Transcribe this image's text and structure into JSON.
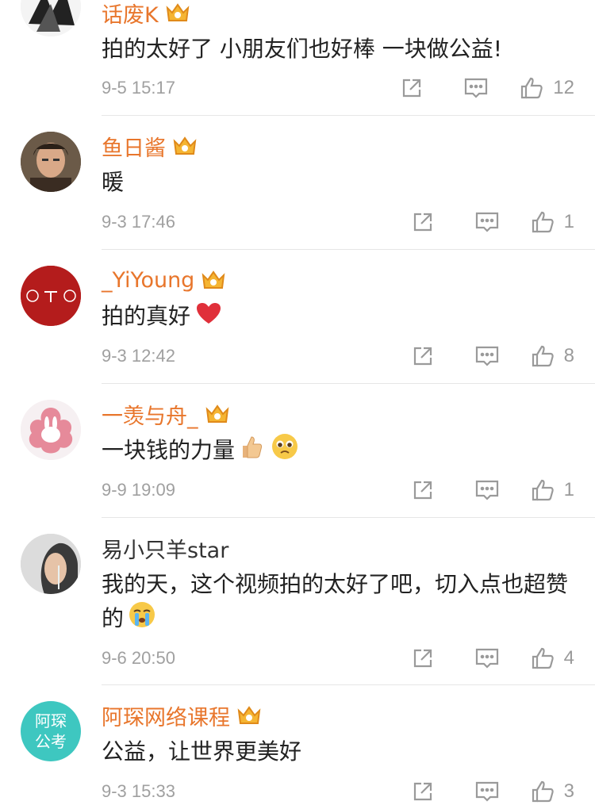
{
  "comments": [
    {
      "user": "话废K",
      "text": "拍的太好了 小朋友们也好棒 一块做公益!",
      "time": "9-5 15:17",
      "likes": "12"
    },
    {
      "user": "鱼日酱",
      "text": "暖",
      "time": "9-3 17:46",
      "likes": "1"
    },
    {
      "user": "_YiYoung",
      "text": "拍的真好",
      "time": "9-3 12:42",
      "likes": "8"
    },
    {
      "user": "一羡与舟_",
      "text": "一块钱的力量",
      "time": "9-9 19:09",
      "likes": "1"
    },
    {
      "user": "易小只羊star",
      "text": "我的天，这个视频拍的太好了吧，切入点也超赞的",
      "time": "9-6 20:50",
      "likes": "4"
    },
    {
      "user": "阿琛网络课程",
      "text": "公益，让世界更美好",
      "time": "9-3 15:33",
      "likes": "3",
      "avatar_text": "阿琛公考"
    }
  ],
  "colors": {
    "vip_name": "#e8762c",
    "plain_name": "#333333",
    "meta": "#a0a0a0",
    "icon": "#9a9a9a"
  }
}
